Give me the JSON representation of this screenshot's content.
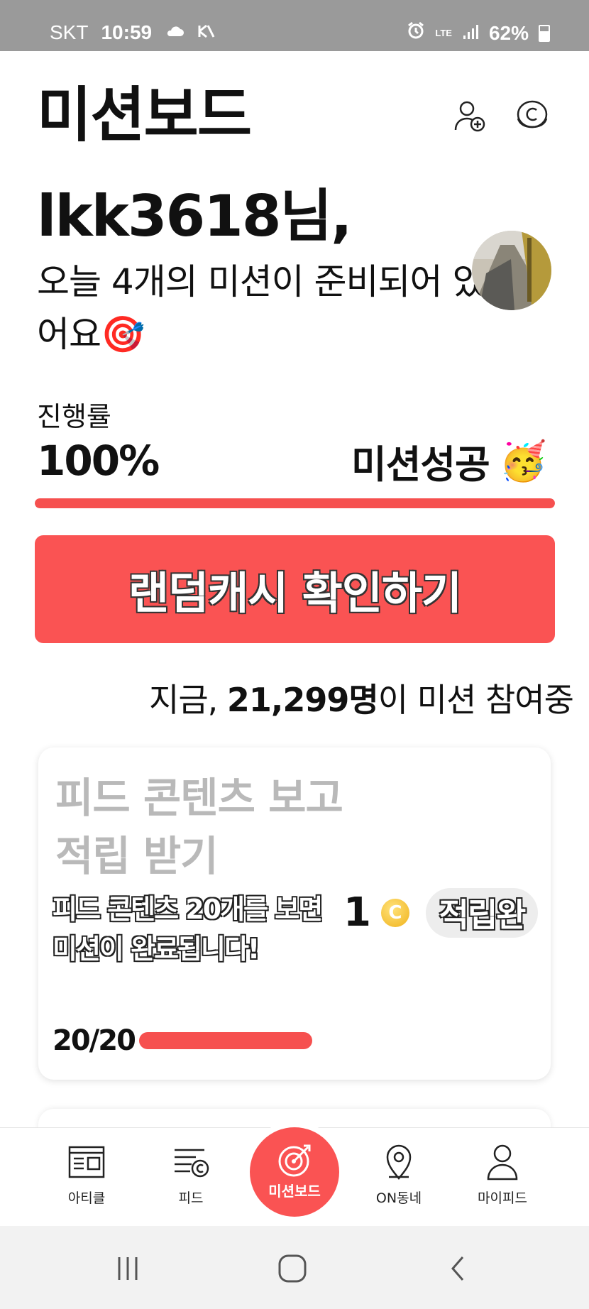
{
  "status_bar": {
    "carrier": "SKT",
    "time": "10:59",
    "network": "LTE",
    "battery": "62%"
  },
  "header": {
    "title": "미션보드",
    "icons": [
      "add-friend-icon",
      "coin-icon"
    ]
  },
  "greeting": {
    "user": "lkk3618님,",
    "message": "오늘 4개의 미션이 준비되어 있어요",
    "emoji": "🎯"
  },
  "progress": {
    "label": "진행률",
    "value": "100%",
    "fraction": 1.0,
    "status": "미션성공",
    "status_emoji": "🥳"
  },
  "cta": {
    "label": "랜덤캐시 확인하기"
  },
  "ticker": {
    "prefix": "지금,",
    "count": "21,299명",
    "suffix": "이 미션 참여중"
  },
  "missions": [
    {
      "title": "피드 콘텐츠 보고 적립 받기",
      "description": "피드 콘텐츠 20개를 보면 미션이 완료됩니다!",
      "progress_text": "20/20",
      "progress_fraction": 1.0,
      "reward": "1",
      "reward_coin_symbol": "C",
      "badge": "적립완"
    }
  ],
  "bottom_nav": {
    "items": [
      {
        "label": "아티클",
        "icon": "article-icon"
      },
      {
        "label": "피드",
        "icon": "feed-icon"
      },
      {
        "label": "미션보드",
        "icon": "target-icon"
      },
      {
        "label": "ON동네",
        "icon": "location-pin-icon"
      },
      {
        "label": "마이피드",
        "icon": "person-icon"
      }
    ]
  },
  "colors": {
    "accent": "#fa5353",
    "status_bar": "#9a9a9a",
    "muted_text": "#b9b9b9"
  }
}
